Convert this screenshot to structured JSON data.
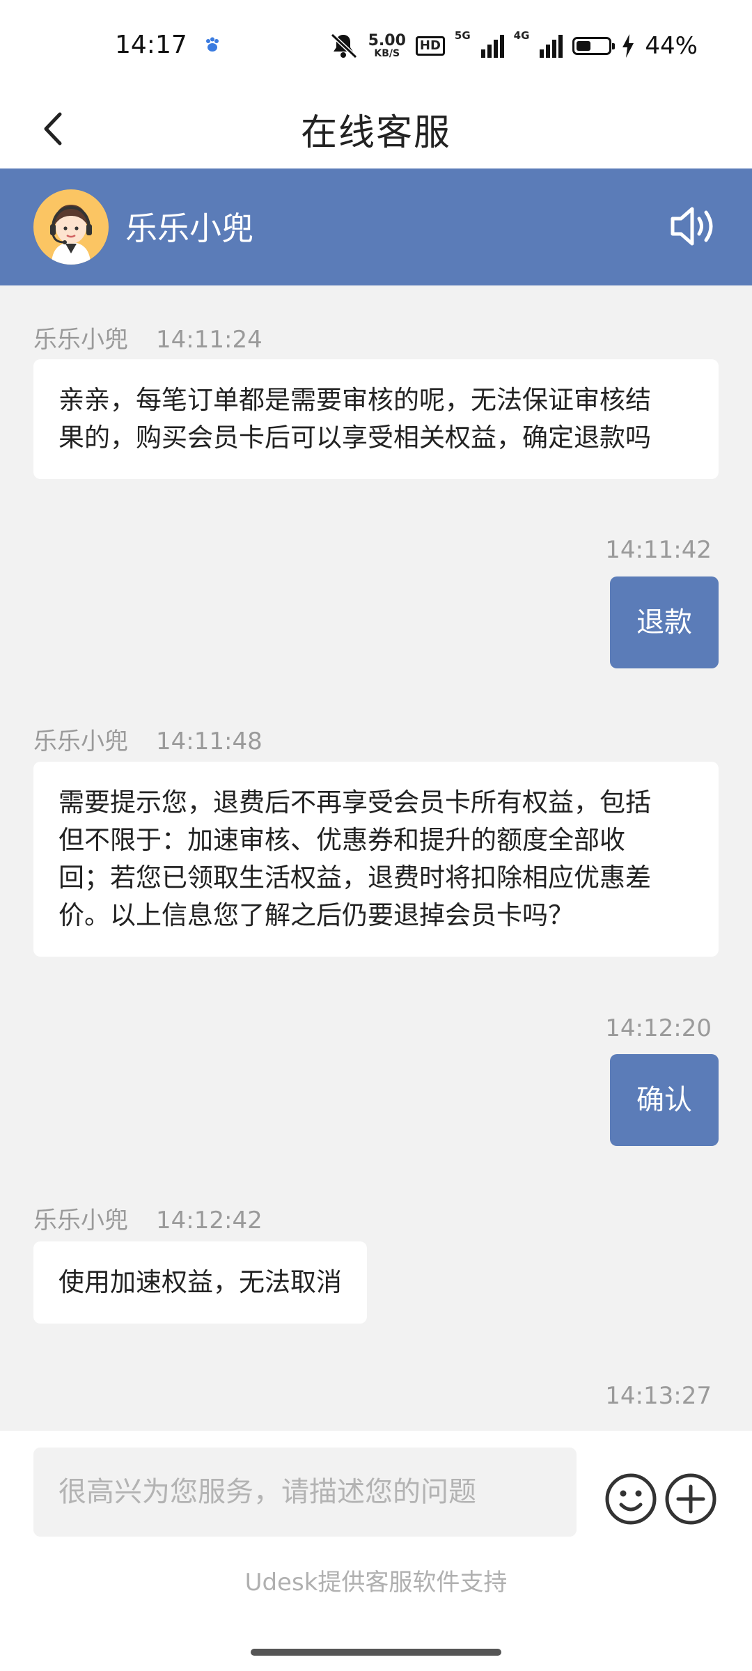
{
  "status_bar": {
    "time": "14:17",
    "net_speed_value": "5.00",
    "net_speed_unit": "KB/S",
    "hd_label": "HD",
    "sim1_label": "5G",
    "sim2_label": "4G",
    "battery_level": 0.44,
    "battery_percent": "44%"
  },
  "title_bar": {
    "title": "在线客服"
  },
  "agent": {
    "name": "乐乐小兜"
  },
  "messages": [
    {
      "from": "agent",
      "sender": "乐乐小兜",
      "time": "14:11:24",
      "lines": [
        "亲亲，每笔订单都是需要审核的呢，无法保证审核结",
        "果的，购买会员卡后可以享受相关权益，确定退款吗"
      ]
    },
    {
      "from": "user",
      "time": "14:11:42",
      "text": "退款"
    },
    {
      "from": "agent",
      "sender": "乐乐小兜",
      "time": "14:11:48",
      "lines": [
        "需要提示您，退费后不再享受会员卡所有权益，包括",
        "但不限于：加速审核、优惠券和提升的额度全部收",
        "回；若您已领取生活权益，退费时将扣除相应优惠差",
        "价。以上信息您了解之后仍要退掉会员卡吗？"
      ]
    },
    {
      "from": "user",
      "time": "14:12:20",
      "text": "确认"
    },
    {
      "from": "agent",
      "sender": "乐乐小兜",
      "time": "14:12:42",
      "lines": [
        "使用加速权益，无法取消"
      ]
    },
    {
      "from": "user",
      "time": "14:13:27"
    }
  ],
  "composer": {
    "placeholder": "很高兴为您服务，请描述您的问题",
    "powered_by": "Udesk提供客服软件支持"
  },
  "colors": {
    "accent": "#5b7cb8",
    "background": "#f2f2f2",
    "avatar_bg": "#fbc563"
  }
}
